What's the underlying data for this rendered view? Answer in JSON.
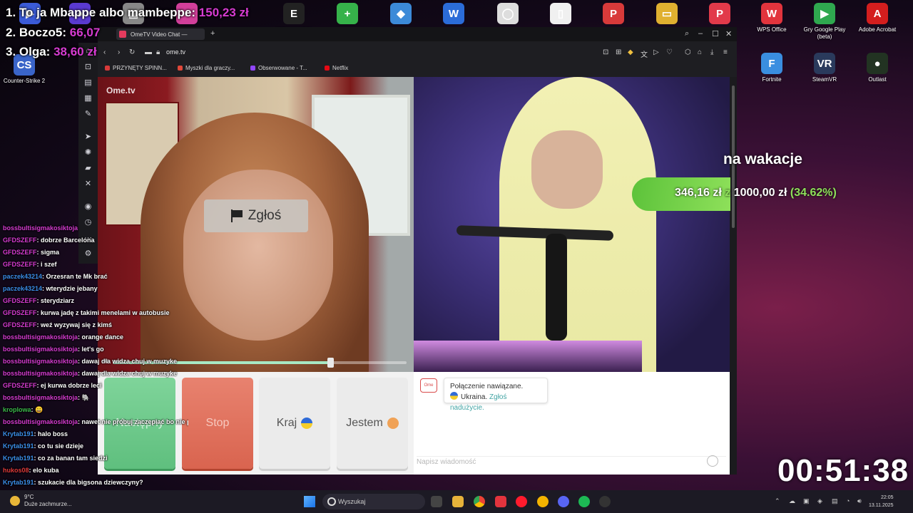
{
  "desktop": {
    "icons_top": [
      {
        "label": "",
        "color": "#3b5bd8",
        "glyph": "▶"
      },
      {
        "label": "",
        "color": "#5a3ad0",
        "glyph": "●"
      },
      {
        "label": "",
        "color": "#888888",
        "glyph": "▤"
      },
      {
        "label": "",
        "color": "#d23f9a",
        "glyph": "◐"
      },
      {
        "label": "EPIC GAMES",
        "color": "#222222",
        "glyph": "E"
      },
      {
        "label": "",
        "color": "#36b24a",
        "glyph": "+"
      },
      {
        "label": "",
        "color": "#3c8ad8",
        "glyph": "◆"
      },
      {
        "label": "",
        "color": "#2b6cd8",
        "glyph": "W"
      },
      {
        "label": "",
        "color": "#dddddd",
        "glyph": "◯"
      },
      {
        "label": "",
        "color": "#f0f0f0",
        "glyph": "▯"
      },
      {
        "label": "",
        "color": "#d83a3a",
        "glyph": "P"
      },
      {
        "label": "",
        "color": "#e0b030",
        "glyph": "▭"
      },
      {
        "label": "",
        "color": "#e23a4a",
        "glyph": "P"
      }
    ],
    "icons_right": [
      {
        "label": "WPS Office",
        "color": "#e2343d",
        "glyph": "W"
      },
      {
        "label": "Gry Google Play (beta)",
        "color": "#2fa84f",
        "glyph": "▶"
      },
      {
        "label": "Adobe Acrobat",
        "color": "#d41e1e",
        "glyph": "A"
      },
      {
        "label": "Fortnite",
        "color": "#3a8ee0",
        "glyph": "F"
      },
      {
        "label": "SteamVR",
        "color": "#2a3a5c",
        "glyph": "VR"
      },
      {
        "label": "Outlast",
        "color": "#223322",
        "glyph": "●"
      }
    ],
    "icon_left_bottom": {
      "label": "Counter-Strike 2",
      "color": "#3a64c8",
      "glyph": "CS"
    }
  },
  "leaderboard": [
    {
      "rank_name": "1. To ja Mbappe albo mambeppe:",
      "amount": "150,23 zł"
    },
    {
      "rank_name": "2. Boczo5:",
      "amount": "66,07"
    },
    {
      "rank_name": "3. Olga:",
      "amount": "38,60 zł"
    }
  ],
  "goal": {
    "title": "na wakacje",
    "current": "346,16 zł",
    "of_word": "z",
    "target": "1000,00 zł",
    "percent_label": "(34.62%)",
    "progress": 0.3462
  },
  "timer": "00:51:38",
  "stream_chat": [
    {
      "user": "bossbultisigmakosiktoja",
      "color": "#d63bd1",
      "text": ""
    },
    {
      "user": "GFDSZEFF",
      "color": "#d63bd1",
      "text": ": dobrze Barcelona"
    },
    {
      "user": "GFDSZEFF",
      "color": "#d63bd1",
      "text": ": sigma"
    },
    {
      "user": "GFDSZEFF",
      "color": "#d63bd1",
      "text": ": i szef"
    },
    {
      "user": "paczek43214",
      "color": "#3b8ee8",
      "text": ": Orzesran te Mk brać"
    },
    {
      "user": "paczek43214",
      "color": "#3b8ee8",
      "text": ": wterydzie jebany"
    },
    {
      "user": "GFDSZEFF",
      "color": "#d63bd1",
      "text": ": sterydziarz"
    },
    {
      "user": "GFDSZEFF",
      "color": "#d63bd1",
      "text": ": kurwa jadę z takimi menelami w autobusie"
    },
    {
      "user": "GFDSZEFF",
      "color": "#d63bd1",
      "text": ": weź wyzywaj się z kimś"
    },
    {
      "user": "bossbultisigmakosiktoja",
      "color": "#d63bd1",
      "text": ": orange dance"
    },
    {
      "user": "bossbultisigmakosiktoja",
      "color": "#d63bd1",
      "text": ": let's go"
    },
    {
      "user": "bossbultisigmakosiktoja",
      "color": "#d63bd1",
      "text": ": dawaj dla widza chuj w muzyke"
    },
    {
      "user": "bossbultisigmakosiktoja",
      "color": "#d63bd1",
      "text": ": dawaj dla widza chuj w muzyke"
    },
    {
      "user": "GFDSZEFF",
      "color": "#d63bd1",
      "text": ": ej kurwa dobrze leci"
    },
    {
      "user": "bossbultisigmakosiktoja",
      "color": "#d63bd1",
      "text": ": 🐘"
    },
    {
      "user": "kroplowa",
      "color": "#3bb84a",
      "text": ": 😀"
    },
    {
      "user": "bossbultisigmakosiktoja",
      "color": "#d63bd1",
      "text": ": nawet nie próbuj zaczepiać bo nie przyjdę do szkoły"
    },
    {
      "user": "Krytab191",
      "color": "#3b8ee8",
      "text": ": halo boss"
    },
    {
      "user": "Krytab191",
      "color": "#3b8ee8",
      "text": ": co tu sie dzieje"
    },
    {
      "user": "Krytab191",
      "color": "#3b8ee8",
      "text": ": co za banan tam siedzi"
    },
    {
      "user": "hukos08",
      "color": "#e03a3a",
      "text": ": elo kuba"
    },
    {
      "user": "Krytab191",
      "color": "#3b8ee8",
      "text": ": szukacie dla bigsona dziewczyny?"
    }
  ],
  "browser": {
    "tab_title": "OmeTV Video Chat —",
    "new_tab": "+",
    "url": "ome.tv",
    "bookmarks": [
      {
        "label": "PRZYNĘTY SPINN...",
        "color": "#d83a3a"
      },
      {
        "label": "Myszki dla graczy...",
        "color": "#e0483a"
      },
      {
        "label": "Obserwowane - T...",
        "color": "#9146ff"
      },
      {
        "label": "Netflix",
        "color": "#e50914"
      }
    ],
    "sidebar_icons": [
      "home-icon",
      "history-icon",
      "wallet-icon",
      "news-icon",
      "notes-icon",
      "spacer",
      "arrow-icon",
      "chatgpt-icon",
      "twitch-icon",
      "x-icon",
      "spacer",
      "circle-icon",
      "clock-icon",
      "more-icon",
      "settings-icon"
    ]
  },
  "ometv": {
    "logo": "Ome.tv",
    "report_label": "Zgłoś",
    "volume": 0.74,
    "buttons": {
      "next": "Następny",
      "stop": "Stop",
      "country": "Kraj",
      "iam": "Jestem"
    },
    "system_message": {
      "line1": "Połączenie nawiązane.",
      "country": "Ukraina.",
      "report_link": "Zgłoś nadużycie."
    },
    "input_placeholder": "Napisz wiadomość"
  },
  "taskbar": {
    "weather_temp": "9°C",
    "weather_desc": "Duże zachmurze...",
    "search_placeholder": "Wyszukaj",
    "time": "22:05",
    "date": "13.11.2025"
  }
}
